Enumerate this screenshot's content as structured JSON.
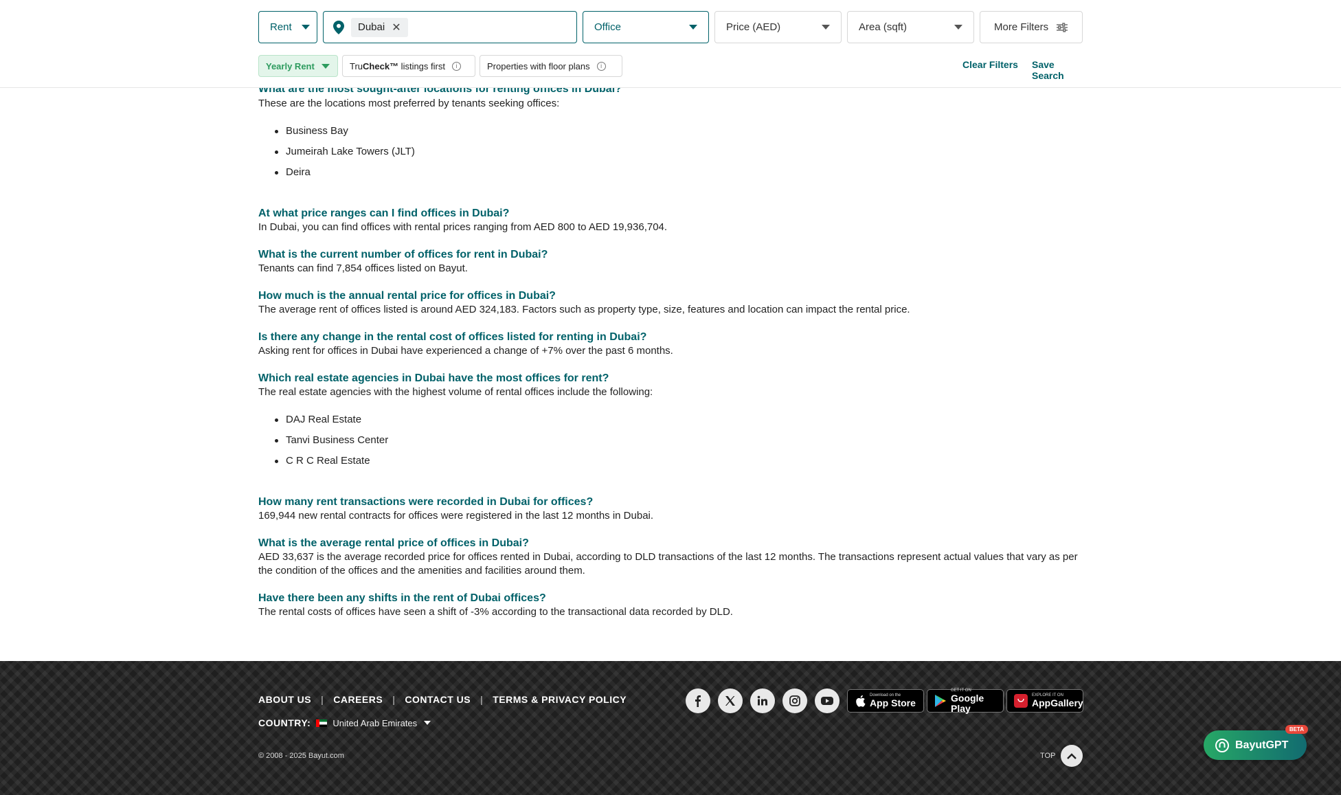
{
  "filters": {
    "purpose": "Rent",
    "location_chip": "Dubai",
    "category": "Office",
    "price": "Price (AED)",
    "area": "Area (sqft)",
    "more_filters": "More Filters"
  },
  "subfilters": {
    "rent_frequency": "Yearly Rent",
    "trucheck_prefix": "Tru",
    "trucheck_bold": "Check™",
    "trucheck_suffix": " listings first",
    "floor_plans": "Properties with floor plans",
    "clear_filters": "Clear Filters",
    "save_search": "Save Search"
  },
  "faq": {
    "q1": "What are the most sought-after locations for renting offices in Dubai?",
    "a1": "These are the locations most preferred by tenants seeking offices:",
    "locations": [
      "Business Bay",
      "Jumeirah Lake Towers (JLT)",
      "Deira"
    ],
    "q2": "At what price ranges can I find offices in Dubai?",
    "a2": "In Dubai, you can find offices with rental prices ranging from AED 800 to AED 19,936,704.",
    "q3": "What is the current number of offices for rent in Dubai?",
    "a3": "Tenants can find 7,854 offices listed on Bayut.",
    "q4": "How much is the annual rental price for offices in Dubai?",
    "a4": "The average rent of offices listed is around AED 324,183. Factors such as property type, size, features and location can impact the rental price.",
    "q5": "Is there any change in the rental cost of offices listed for renting in Dubai?",
    "a5": "Asking rent for offices in Dubai have experienced a change of +7% over the past 6 months.",
    "q6": "Which real estate agencies in Dubai have the most offices for rent?",
    "a6": "The real estate agencies with the highest volume of rental offices include the following:",
    "agencies": [
      "DAJ Real Estate",
      "Tanvi Business Center",
      "C R C Real Estate"
    ],
    "q7": "How many rent transactions were recorded in Dubai for offices?",
    "a7": "169,944 new rental contracts for offices were registered in the last 12 months in Dubai.",
    "q8": "What is the average rental price of offices in Dubai?",
    "a8": "AED 33,637 is the average recorded price for offices rented in Dubai, according to DLD transactions of the last 12 months. The transactions represent actual values that vary as per the condition of the offices and the amenities and facilities around them.",
    "q9": "Have there been any shifts in the rent of Dubai offices?",
    "a9": "The rental costs of offices have seen a shift of -3% according to the transactional data recorded by DLD."
  },
  "footer": {
    "links": [
      "ABOUT US",
      "CAREERS",
      "CONTACT US",
      "TERMS & PRIVACY POLICY"
    ],
    "separator": "|",
    "country_label": "COUNTRY:",
    "country_value": "United Arab Emirates",
    "copyright": "© 2008 - 2025 Bayut.com",
    "top_label": "TOP",
    "app_store": {
      "small": "Download on the",
      "big": "App Store"
    },
    "google_play": {
      "small": "GET IT ON",
      "big": "Google Play"
    },
    "app_gallery": {
      "small": "EXPLORE IT ON",
      "big": "AppGallery"
    }
  },
  "assistant": {
    "label": "BayutGPT",
    "badge": "BETA"
  },
  "colors": {
    "brand_teal": "#006169",
    "accent_green": "#2d9b5e",
    "footer_bg": "#1f1f1f"
  }
}
